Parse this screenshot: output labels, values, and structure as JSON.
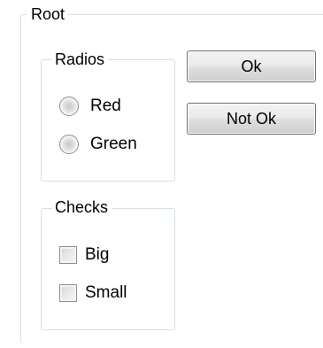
{
  "root": {
    "title": "Root"
  },
  "radios": {
    "title": "Radios",
    "options": [
      {
        "label": "Red",
        "selected": false
      },
      {
        "label": "Green",
        "selected": false
      }
    ]
  },
  "checks": {
    "title": "Checks",
    "options": [
      {
        "label": "Big",
        "checked": false
      },
      {
        "label": "Small",
        "checked": false
      }
    ]
  },
  "buttons": {
    "ok_label": "Ok",
    "not_ok_label": "Not Ok"
  },
  "colors": {
    "group_border": "#d5dfe5",
    "button_border": "#707070",
    "control_border": "#8e8f8f"
  }
}
